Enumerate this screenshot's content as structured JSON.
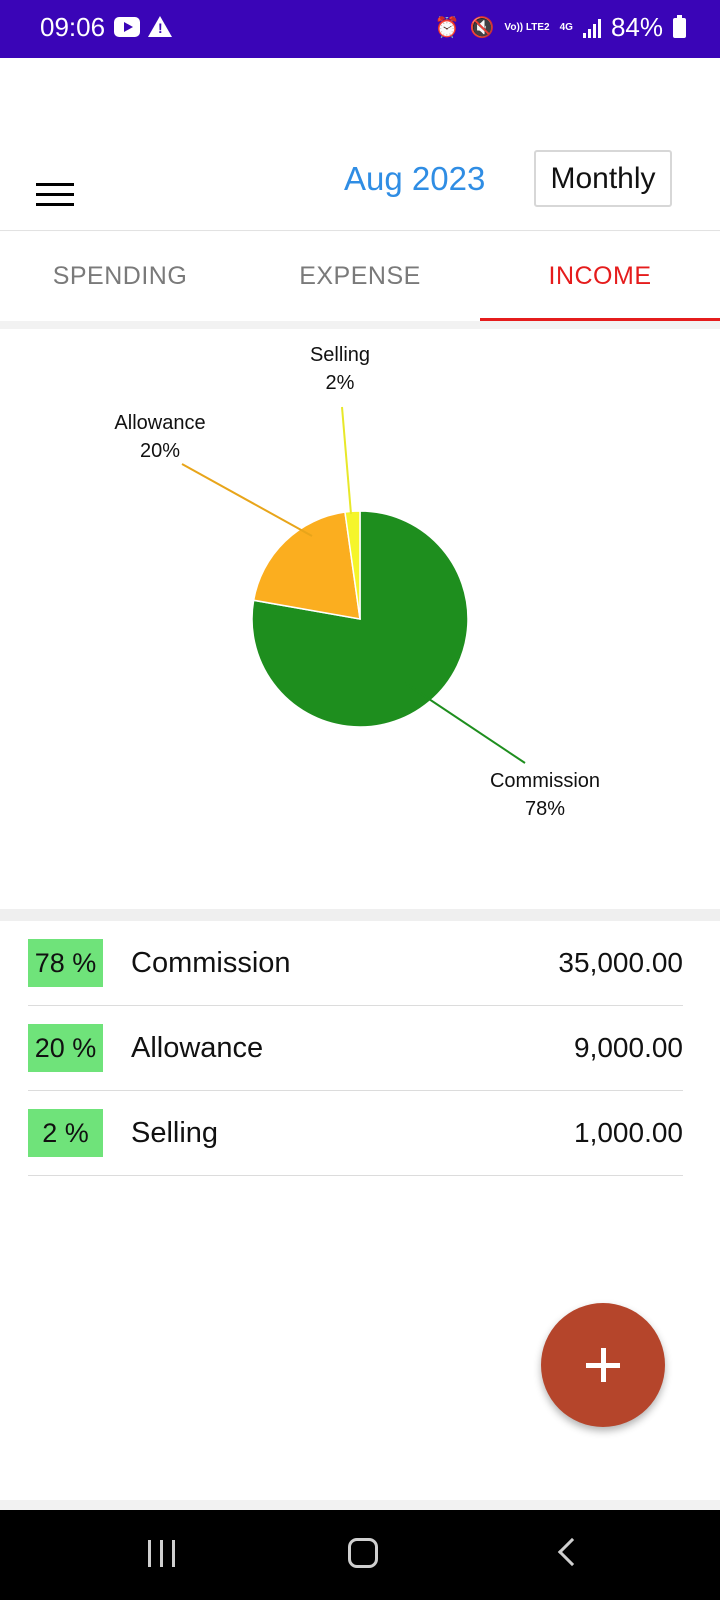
{
  "status_bar": {
    "time": "09:06",
    "battery": "84%",
    "network_small_1": "Vo)) LTE2",
    "network_small_2": "4G"
  },
  "header": {
    "menu_icon": "hamburger-icon",
    "month": "Aug 2023",
    "period_button": "Monthly"
  },
  "tabs": [
    {
      "label": "SPENDING",
      "active": false
    },
    {
      "label": "EXPENSE",
      "active": false
    },
    {
      "label": "INCOME",
      "active": true
    }
  ],
  "colors": {
    "status_bar": "#3a05b7",
    "accent_blue": "#2f8de4",
    "active_tab": "#e51c1c",
    "badge_green": "#6fe37a",
    "fab": "#b5452b"
  },
  "chart_data": {
    "type": "pie",
    "slices": [
      {
        "label": "Commission",
        "percent_label": "78%",
        "value": 35000,
        "color": "#1e8e1e"
      },
      {
        "label": "Allowance",
        "percent_label": "20%",
        "value": 9000,
        "color": "#fbae1f"
      },
      {
        "label": "Selling",
        "percent_label": "2%",
        "value": 1000,
        "color": "#f5f52a"
      }
    ]
  },
  "list": [
    {
      "percent": "78 %",
      "name": "Commission",
      "amount": "35,000.00"
    },
    {
      "percent": "20 %",
      "name": "Allowance",
      "amount": "9,000.00"
    },
    {
      "percent": "2 %",
      "name": "Selling",
      "amount": "1,000.00"
    }
  ],
  "fab": {
    "icon": "plus-icon"
  },
  "nav_bar": {
    "icons": [
      "recent-apps-icon",
      "home-icon",
      "back-icon"
    ]
  }
}
